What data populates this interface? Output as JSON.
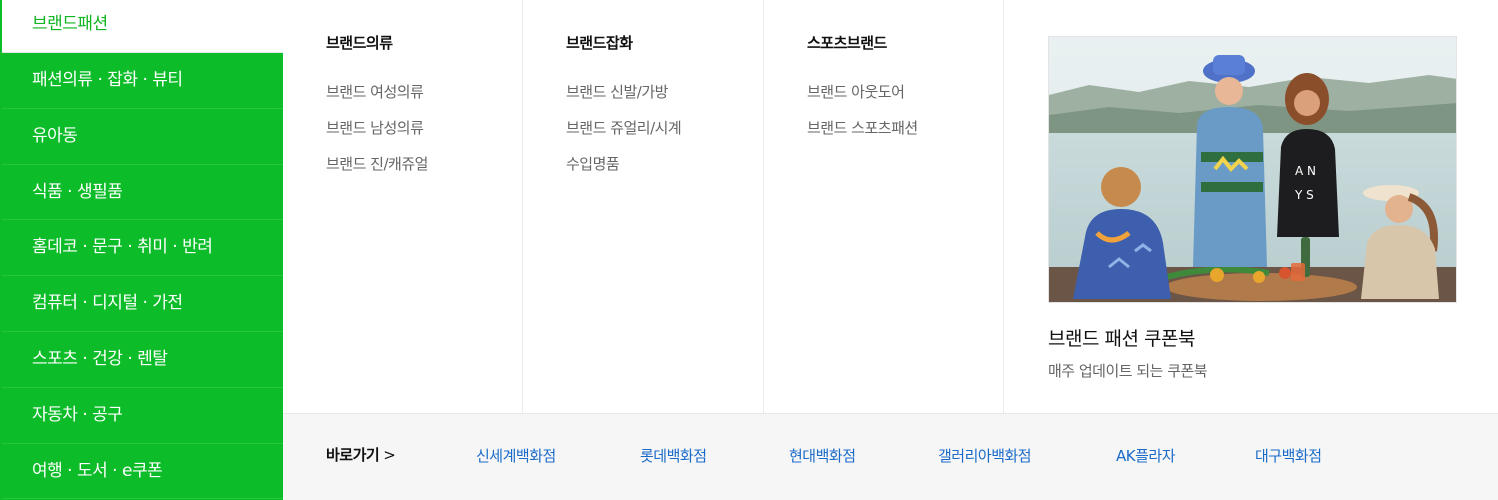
{
  "sidebar": {
    "active": "브랜드패션",
    "items": [
      "패션의류 · 잡화 · 뷰티",
      "유아동",
      "식품 · 생필품",
      "홈데코 · 문구 · 취미 · 반려",
      "컴퓨터 · 디지털 · 가전",
      "스포츠 · 건강 · 렌탈",
      "자동차 · 공구",
      "여행 · 도서 · e쿠폰"
    ]
  },
  "columns": [
    {
      "title": "브랜드의류",
      "links": [
        "브랜드 여성의류",
        "브랜드 남성의류",
        "브랜드 진/캐쥬얼"
      ]
    },
    {
      "title": "브랜드잡화",
      "links": [
        "브랜드 신발/가방",
        "브랜드 쥬얼리/시계",
        "수입명품"
      ]
    },
    {
      "title": "스포츠브랜드",
      "links": [
        "브랜드 아웃도어",
        "브랜드 스포츠패션"
      ]
    }
  ],
  "promo": {
    "title": "브랜드 패션 쿠폰북",
    "subtitle": "매주 업데이트 되는 쿠폰북"
  },
  "shortcut": {
    "label": "바로가기",
    "chevron": ">",
    "links": [
      "신세계백화점",
      "롯데백화점",
      "현대백화점",
      "갤러리아백화점",
      "AK플라자",
      "대구백화점"
    ]
  },
  "colors": {
    "accent": "#0cbc28",
    "link": "#1a6bc9"
  }
}
